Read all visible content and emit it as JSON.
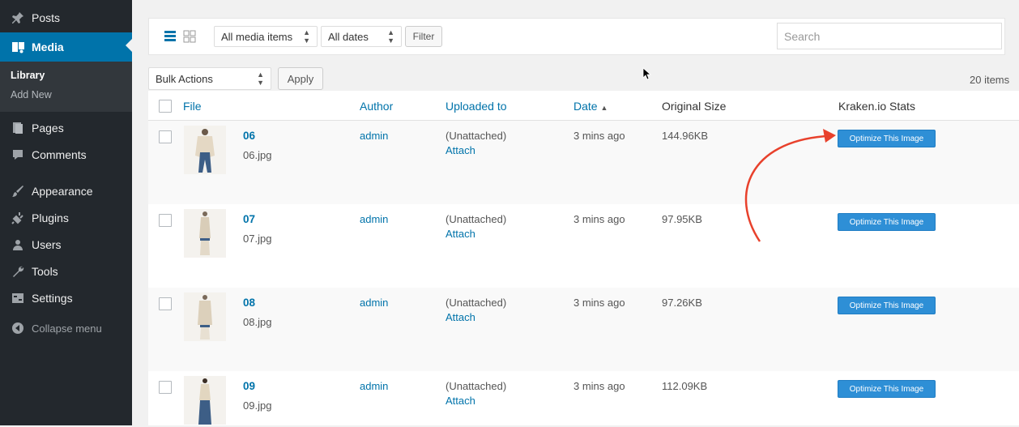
{
  "sidebar": {
    "items": [
      {
        "label": "Posts",
        "icon": "pin-icon"
      },
      {
        "label": "Media",
        "icon": "media-icon"
      },
      {
        "label": "Pages",
        "icon": "pages-icon"
      },
      {
        "label": "Comments",
        "icon": "comment-icon"
      },
      {
        "label": "Appearance",
        "icon": "brush-icon"
      },
      {
        "label": "Plugins",
        "icon": "plug-icon"
      },
      {
        "label": "Users",
        "icon": "user-icon"
      },
      {
        "label": "Tools",
        "icon": "wrench-icon"
      },
      {
        "label": "Settings",
        "icon": "settings-icon"
      },
      {
        "label": "Collapse menu",
        "icon": "collapse-icon"
      }
    ],
    "submenu": [
      "Library",
      "Add New"
    ]
  },
  "toolbar": {
    "media_filter": "All media items",
    "date_filter": "All dates",
    "filter_label": "Filter",
    "search_placeholder": "Search"
  },
  "bulk": {
    "action": "Bulk Actions",
    "apply_label": "Apply",
    "count": "20 items"
  },
  "columns": [
    "File",
    "Author",
    "Uploaded to",
    "Date",
    "Original Size",
    "Kraken.io Stats"
  ],
  "sort_indicator": "▲",
  "rows": [
    {
      "title": "06",
      "filename": "06.jpg",
      "author": "admin",
      "uploaded": "(Unattached)",
      "attach": "Attach",
      "date": "3 mins ago",
      "size": "144.96KB",
      "action": "Optimize This Image"
    },
    {
      "title": "07",
      "filename": "07.jpg",
      "author": "admin",
      "uploaded": "(Unattached)",
      "attach": "Attach",
      "date": "3 mins ago",
      "size": "97.95KB",
      "action": "Optimize This Image"
    },
    {
      "title": "08",
      "filename": "08.jpg",
      "author": "admin",
      "uploaded": "(Unattached)",
      "attach": "Attach",
      "date": "3 mins ago",
      "size": "97.26KB",
      "action": "Optimize This Image"
    },
    {
      "title": "09",
      "filename": "09.jpg",
      "author": "admin",
      "uploaded": "(Unattached)",
      "attach": "Attach",
      "date": "3 mins ago",
      "size": "112.09KB",
      "action": "Optimize This Image"
    }
  ],
  "colors": {
    "sidebar_bg": "#23282d",
    "accent": "#0073aa",
    "button_blue": "#2e8fd6",
    "annotation_arrow": "#e8412c"
  }
}
